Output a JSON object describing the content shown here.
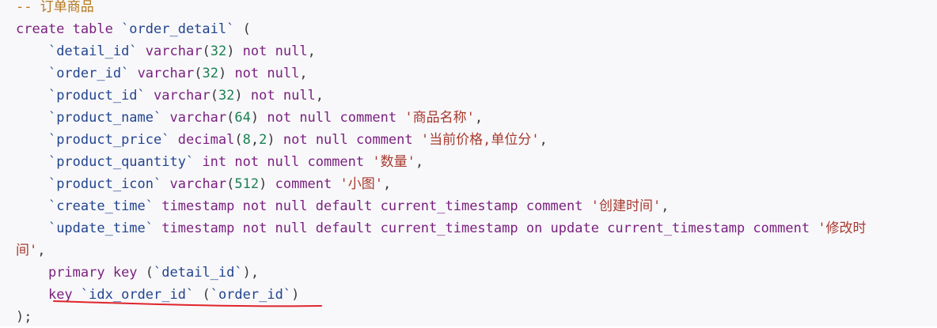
{
  "code": {
    "language": "sql",
    "lines": [
      [
        {
          "t": "c",
          "v": "-- 订单商品"
        }
      ],
      [
        {
          "t": "k",
          "v": "create table "
        },
        {
          "t": "i",
          "v": "`order_detail`"
        },
        {
          "t": "p",
          "v": " ("
        }
      ],
      [
        {
          "t": "p",
          "v": "    "
        },
        {
          "t": "i",
          "v": "`detail_id`"
        },
        {
          "t": "p",
          "v": " "
        },
        {
          "t": "k",
          "v": "varchar"
        },
        {
          "t": "p",
          "v": "("
        },
        {
          "t": "n",
          "v": "32"
        },
        {
          "t": "p",
          "v": ") "
        },
        {
          "t": "k",
          "v": "not null"
        },
        {
          "t": "p",
          "v": ","
        }
      ],
      [
        {
          "t": "p",
          "v": "    "
        },
        {
          "t": "i",
          "v": "`order_id`"
        },
        {
          "t": "p",
          "v": " "
        },
        {
          "t": "k",
          "v": "varchar"
        },
        {
          "t": "p",
          "v": "("
        },
        {
          "t": "n",
          "v": "32"
        },
        {
          "t": "p",
          "v": ") "
        },
        {
          "t": "k",
          "v": "not null"
        },
        {
          "t": "p",
          "v": ","
        }
      ],
      [
        {
          "t": "p",
          "v": "    "
        },
        {
          "t": "i",
          "v": "`product_id`"
        },
        {
          "t": "p",
          "v": " "
        },
        {
          "t": "k",
          "v": "varchar"
        },
        {
          "t": "p",
          "v": "("
        },
        {
          "t": "n",
          "v": "32"
        },
        {
          "t": "p",
          "v": ") "
        },
        {
          "t": "k",
          "v": "not null"
        },
        {
          "t": "p",
          "v": ","
        }
      ],
      [
        {
          "t": "p",
          "v": "    "
        },
        {
          "t": "i",
          "v": "`product_name`"
        },
        {
          "t": "p",
          "v": " "
        },
        {
          "t": "k",
          "v": "varchar"
        },
        {
          "t": "p",
          "v": "("
        },
        {
          "t": "n",
          "v": "64"
        },
        {
          "t": "p",
          "v": ") "
        },
        {
          "t": "k",
          "v": "not null comment"
        },
        {
          "t": "p",
          "v": " "
        },
        {
          "t": "s",
          "v": "'商品名称'"
        },
        {
          "t": "p",
          "v": ","
        }
      ],
      [
        {
          "t": "p",
          "v": "    "
        },
        {
          "t": "i",
          "v": "`product_price`"
        },
        {
          "t": "p",
          "v": " "
        },
        {
          "t": "k",
          "v": "decimal"
        },
        {
          "t": "p",
          "v": "("
        },
        {
          "t": "n",
          "v": "8"
        },
        {
          "t": "p",
          "v": ","
        },
        {
          "t": "n",
          "v": "2"
        },
        {
          "t": "p",
          "v": ") "
        },
        {
          "t": "k",
          "v": "not null comment"
        },
        {
          "t": "p",
          "v": " "
        },
        {
          "t": "s",
          "v": "'当前价格,单位分'"
        },
        {
          "t": "p",
          "v": ","
        }
      ],
      [
        {
          "t": "p",
          "v": "    "
        },
        {
          "t": "i",
          "v": "`product_quantity`"
        },
        {
          "t": "p",
          "v": " "
        },
        {
          "t": "k",
          "v": "int not null comment"
        },
        {
          "t": "p",
          "v": " "
        },
        {
          "t": "s",
          "v": "'数量'"
        },
        {
          "t": "p",
          "v": ","
        }
      ],
      [
        {
          "t": "p",
          "v": "    "
        },
        {
          "t": "i",
          "v": "`product_icon`"
        },
        {
          "t": "p",
          "v": " "
        },
        {
          "t": "k",
          "v": "varchar"
        },
        {
          "t": "p",
          "v": "("
        },
        {
          "t": "n",
          "v": "512"
        },
        {
          "t": "p",
          "v": ") "
        },
        {
          "t": "k",
          "v": "comment"
        },
        {
          "t": "p",
          "v": " "
        },
        {
          "t": "s",
          "v": "'小图'"
        },
        {
          "t": "p",
          "v": ","
        }
      ],
      [
        {
          "t": "p",
          "v": "    "
        },
        {
          "t": "i",
          "v": "`create_time`"
        },
        {
          "t": "p",
          "v": " "
        },
        {
          "t": "k",
          "v": "timestamp not null default current_timestamp comment"
        },
        {
          "t": "p",
          "v": " "
        },
        {
          "t": "s",
          "v": "'创建时间'"
        },
        {
          "t": "p",
          "v": ","
        }
      ],
      [
        {
          "t": "p",
          "v": "    "
        },
        {
          "t": "i",
          "v": "`update_time`"
        },
        {
          "t": "p",
          "v": " "
        },
        {
          "t": "k",
          "v": "timestamp not null default current_timestamp on update current_timestamp comment"
        },
        {
          "t": "p",
          "v": " "
        },
        {
          "t": "s",
          "v": "'修改时"
        }
      ],
      [
        {
          "t": "s",
          "v": "间'"
        },
        {
          "t": "p",
          "v": ","
        }
      ],
      [
        {
          "t": "p",
          "v": "    "
        },
        {
          "t": "k",
          "v": "primary key"
        },
        {
          "t": "p",
          "v": " ("
        },
        {
          "t": "i",
          "v": "`detail_id`"
        },
        {
          "t": "p",
          "v": "),"
        }
      ],
      [
        {
          "t": "p",
          "v": "    "
        },
        {
          "t": "k",
          "v": "key"
        },
        {
          "t": "p",
          "v": " "
        },
        {
          "t": "i",
          "v": "`idx_order_id`"
        },
        {
          "t": "p",
          "v": " ("
        },
        {
          "t": "i",
          "v": "`order_id`"
        },
        {
          "t": "p",
          "v": ")"
        }
      ],
      [
        {
          "t": "p",
          "v": ");"
        }
      ]
    ]
  },
  "colors": {
    "background": "#f8f8fa",
    "comment": "#b5781f",
    "keyword": "#7a1f7f",
    "identifier": "#22448f",
    "number": "#1b8051",
    "string": "#a83a2f",
    "annotation": "#e0242c"
  }
}
